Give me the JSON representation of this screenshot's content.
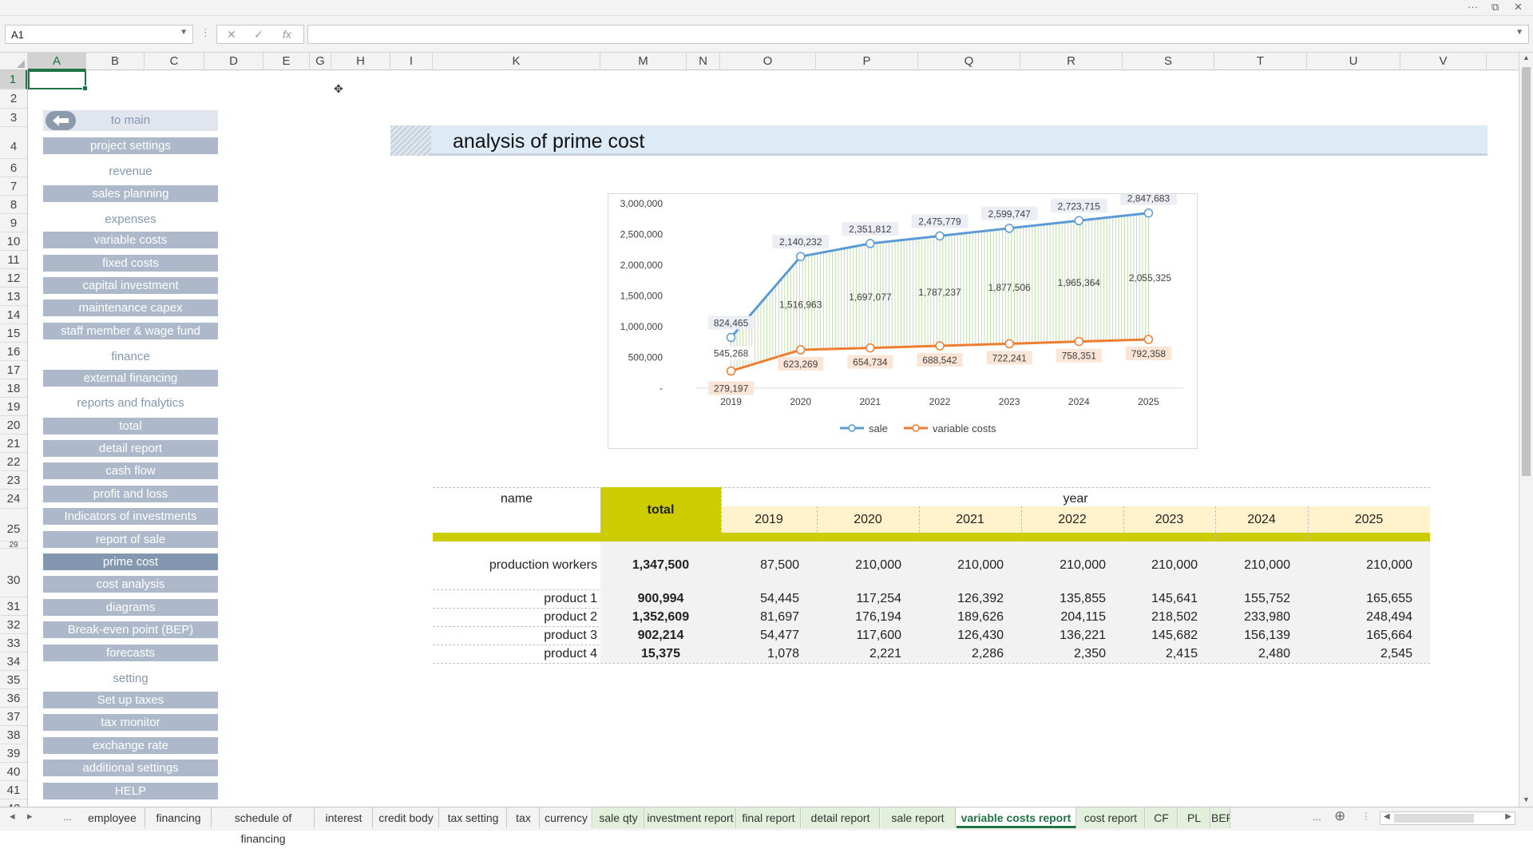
{
  "window": {
    "controls": [
      "···",
      "⧉",
      "✕"
    ]
  },
  "formula_bar": {
    "name_box": "A1",
    "fx": "fx",
    "cancel": "✕",
    "enter": "✓",
    "formula": ""
  },
  "columns": [
    "A",
    "B",
    "C",
    "D",
    "E",
    "G",
    "H",
    "I",
    "K",
    "M",
    "N",
    "O",
    "P",
    "Q",
    "R",
    "S",
    "T",
    "U",
    "V"
  ],
  "rows": [
    "1",
    "2",
    "3",
    "4",
    "6",
    "7",
    "8",
    "9",
    "10",
    "11",
    "12",
    "13",
    "14",
    "15",
    "16",
    "17",
    "18",
    "19",
    "20",
    "21",
    "22",
    "23",
    "24",
    "25",
    "29",
    "30",
    "31",
    "32",
    "33",
    "34",
    "35",
    "36",
    "37",
    "38",
    "39",
    "40",
    "41",
    "42"
  ],
  "nav": {
    "to_main": "to main",
    "project_settings": "project settings",
    "sec_revenue": "revenue",
    "sales_planning": "sales planning",
    "sec_expenses": "expenses",
    "variable_costs": "variable costs",
    "fixed_costs": "fixed costs",
    "capital_investment": "capital investment",
    "maintenance_capex": "maintenance capex",
    "staff_member": "staff member & wage fund",
    "sec_finance": "finance",
    "external_financing": "external financing",
    "sec_reports": "reports and fnalytics",
    "total": "total",
    "detail_report": "detail report",
    "cash_flow": "cash flow",
    "profit_and_loss": "profit and loss",
    "indicators": "Indicators of investments",
    "report_of_sale": "report of sale",
    "prime_cost": "prime cost",
    "cost_analysis": "cost analysis",
    "diagrams": "diagrams",
    "bep": "Break-even point (BEP)",
    "forecasts": "forecasts",
    "sec_setting": "setting",
    "set_up_taxes": "Set up taxes",
    "tax_monitor": "tax monitor",
    "exchange_rate": "exchange rate",
    "additional_settings": "additional settings",
    "help": "HELP"
  },
  "title": "analysis of prime cost",
  "chart_data": {
    "type": "line",
    "categories": [
      "2019",
      "2020",
      "2021",
      "2022",
      "2023",
      "2024",
      "2025"
    ],
    "series": [
      {
        "name": "sale",
        "values": [
          824465,
          2140232,
          2351812,
          2475779,
          2599747,
          2723715,
          2847683
        ],
        "color": "#5b9bd5"
      },
      {
        "name": "variable costs",
        "values": [
          279197,
          623269,
          654734,
          688542,
          722241,
          758351,
          792358
        ],
        "color": "#ed7d31"
      }
    ],
    "difference_labels": [
      "545,268",
      "1,516,963",
      "1,697,077",
      "1,787,237",
      "1,877,506",
      "1,965,364",
      "2,055,325"
    ],
    "sale_labels": [
      "824,465",
      "2,140,232",
      "2,351,812",
      "2,475,779",
      "2,599,747",
      "2,723,715",
      "2,847,683"
    ],
    "cost_labels": [
      "279,197",
      "623,269",
      "654,734",
      "688,542",
      "722,241",
      "758,351",
      "792,358"
    ],
    "y_ticks": [
      "-",
      "500,000",
      "1,000,000",
      "1,500,000",
      "2,000,000",
      "2,500,000",
      "3,000,000"
    ],
    "ylim": [
      0,
      3000000
    ],
    "fill_between": "#a9d18e",
    "legend": "bottom"
  },
  "table": {
    "name_header": "name",
    "total_header": "total",
    "year_header": "year",
    "years": [
      "2019",
      "2020",
      "2021",
      "2022",
      "2023",
      "2024",
      "2025"
    ],
    "rows": [
      {
        "name": "production workers",
        "total": "1,347,500",
        "values": [
          "87,500",
          "210,000",
          "210,000",
          "210,000",
          "210,000",
          "210,000",
          "210,000"
        ]
      },
      {
        "name": "product 1",
        "total": "900,994",
        "values": [
          "54,445",
          "117,254",
          "126,392",
          "135,855",
          "145,641",
          "155,752",
          "165,655"
        ]
      },
      {
        "name": "product 2",
        "total": "1,352,609",
        "values": [
          "81,697",
          "176,194",
          "189,626",
          "204,115",
          "218,502",
          "233,980",
          "248,494"
        ]
      },
      {
        "name": "product 3",
        "total": "902,214",
        "values": [
          "54,477",
          "117,600",
          "126,430",
          "136,221",
          "145,682",
          "156,139",
          "165,664"
        ]
      },
      {
        "name": "product 4",
        "total": "15,375",
        "values": [
          "1,078",
          "2,221",
          "2,286",
          "2,350",
          "2,415",
          "2,480",
          "2,545"
        ]
      }
    ]
  },
  "sheet_tabs": {
    "nav_prev": "◂",
    "nav_next": "▸",
    "more_left": "...",
    "tabs": [
      "employee",
      "financing",
      "schedule of financing",
      "interest",
      "credit body",
      "tax setting",
      "tax",
      "currency",
      "sale qty",
      "investment report",
      "final report",
      "detail report",
      "sale report",
      "variable costs report",
      "cost report",
      "CF",
      "PL",
      "BEP"
    ],
    "more_right": "...",
    "add": "⊕"
  }
}
